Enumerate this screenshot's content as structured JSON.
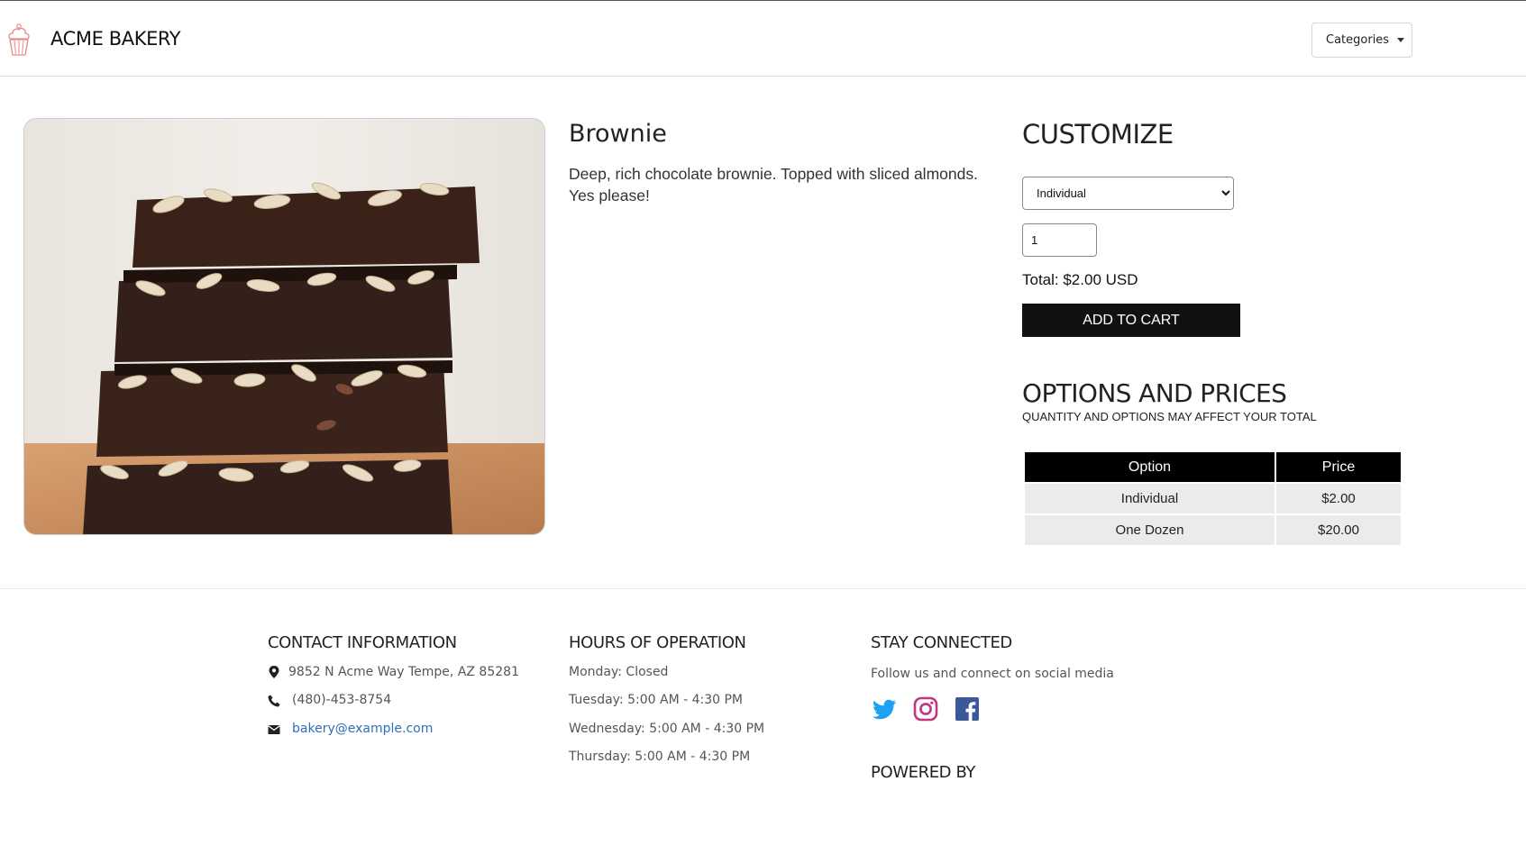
{
  "header": {
    "brand": "ACME BAKERY",
    "categories_label": "Categories"
  },
  "product": {
    "title": "Brownie",
    "description": "Deep, rich chocolate brownie. Topped with sliced almonds. Yes please!",
    "image_alt": "Stack of chocolate brownies topped with sliced almonds"
  },
  "customize": {
    "title": "CUSTOMIZE",
    "selected_option": "Individual",
    "quantity": "1",
    "total": "Total: $2.00 USD",
    "add_to_cart": "ADD TO CART"
  },
  "options": {
    "title": "OPTIONS AND PRICES",
    "subtitle": "QUANTITY AND OPTIONS MAY AFFECT YOUR TOTAL",
    "headers": [
      "Option",
      "Price"
    ],
    "rows": [
      {
        "option": "Individual",
        "price": "$2.00"
      },
      {
        "option": "One Dozen",
        "price": "$20.00"
      }
    ]
  },
  "footer": {
    "contact": {
      "title": "CONTACT INFORMATION",
      "address": "9852 N Acme Way Tempe, AZ 85281",
      "phone": "(480)-453-8754",
      "email": "bakery@example.com"
    },
    "hours": {
      "title": "HOURS OF OPERATION",
      "lines": [
        "Monday: Closed",
        "Tuesday: 5:00 AM - 4:30 PM",
        "Wednesday: 5:00 AM - 4:30 PM",
        "Thursday: 5:00 AM - 4:30 PM"
      ]
    },
    "social": {
      "title": "STAY CONNECTED",
      "subtitle": "Follow us and connect on social media",
      "icons": [
        "twitter-icon",
        "instagram-icon",
        "facebook-icon"
      ]
    },
    "powered_by": "POWERED BY"
  },
  "colors": {
    "accent_black": "#000000",
    "link_blue": "#2f6fb8",
    "twitter": "#1da1f2",
    "instagram": "#c13584",
    "facebook": "#3b5998",
    "logo_pink": "#e58a8a"
  }
}
